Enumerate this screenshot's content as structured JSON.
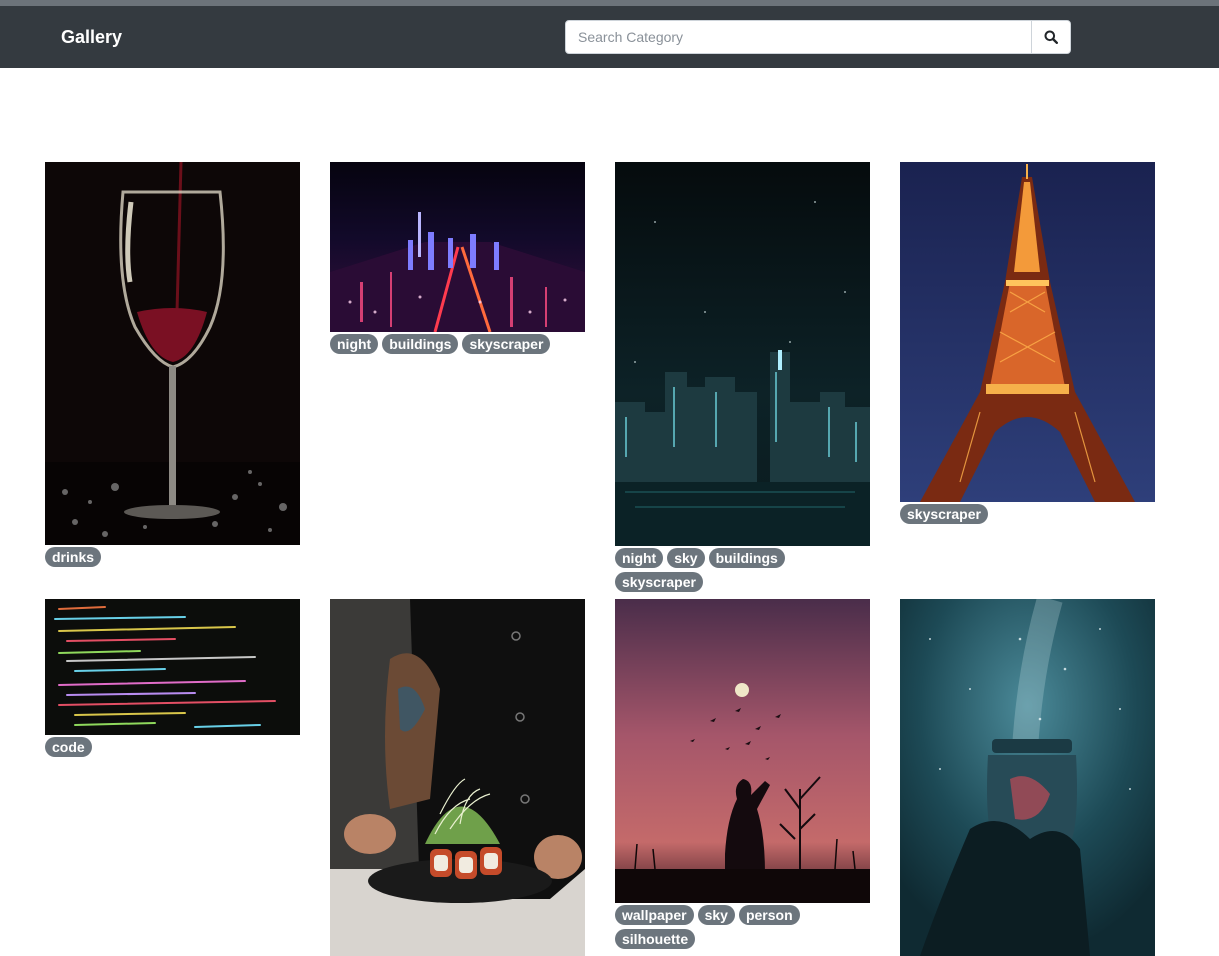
{
  "navbar": {
    "brand": "Gallery",
    "search_placeholder": "Search Category",
    "search_icon": "search-icon"
  },
  "gallery": [
    {
      "subject": "wine-glass",
      "tags": [
        "drinks"
      ]
    },
    {
      "subject": "city-night-aerial",
      "tags": [
        "night",
        "buildings",
        "skyscraper"
      ]
    },
    {
      "subject": "skyline-moon",
      "tags": [
        "night",
        "sky",
        "buildings",
        "skyscraper"
      ]
    },
    {
      "subject": "eiffel-tower",
      "tags": [
        "skyscraper"
      ]
    },
    {
      "subject": "code-screen",
      "tags": [
        "code"
      ]
    },
    {
      "subject": "plated-food",
      "tags": []
    },
    {
      "subject": "silhouette-sunset",
      "tags": [
        "wallpaper",
        "sky",
        "person",
        "silhouette"
      ]
    },
    {
      "subject": "galaxy-jar",
      "tags": []
    }
  ]
}
